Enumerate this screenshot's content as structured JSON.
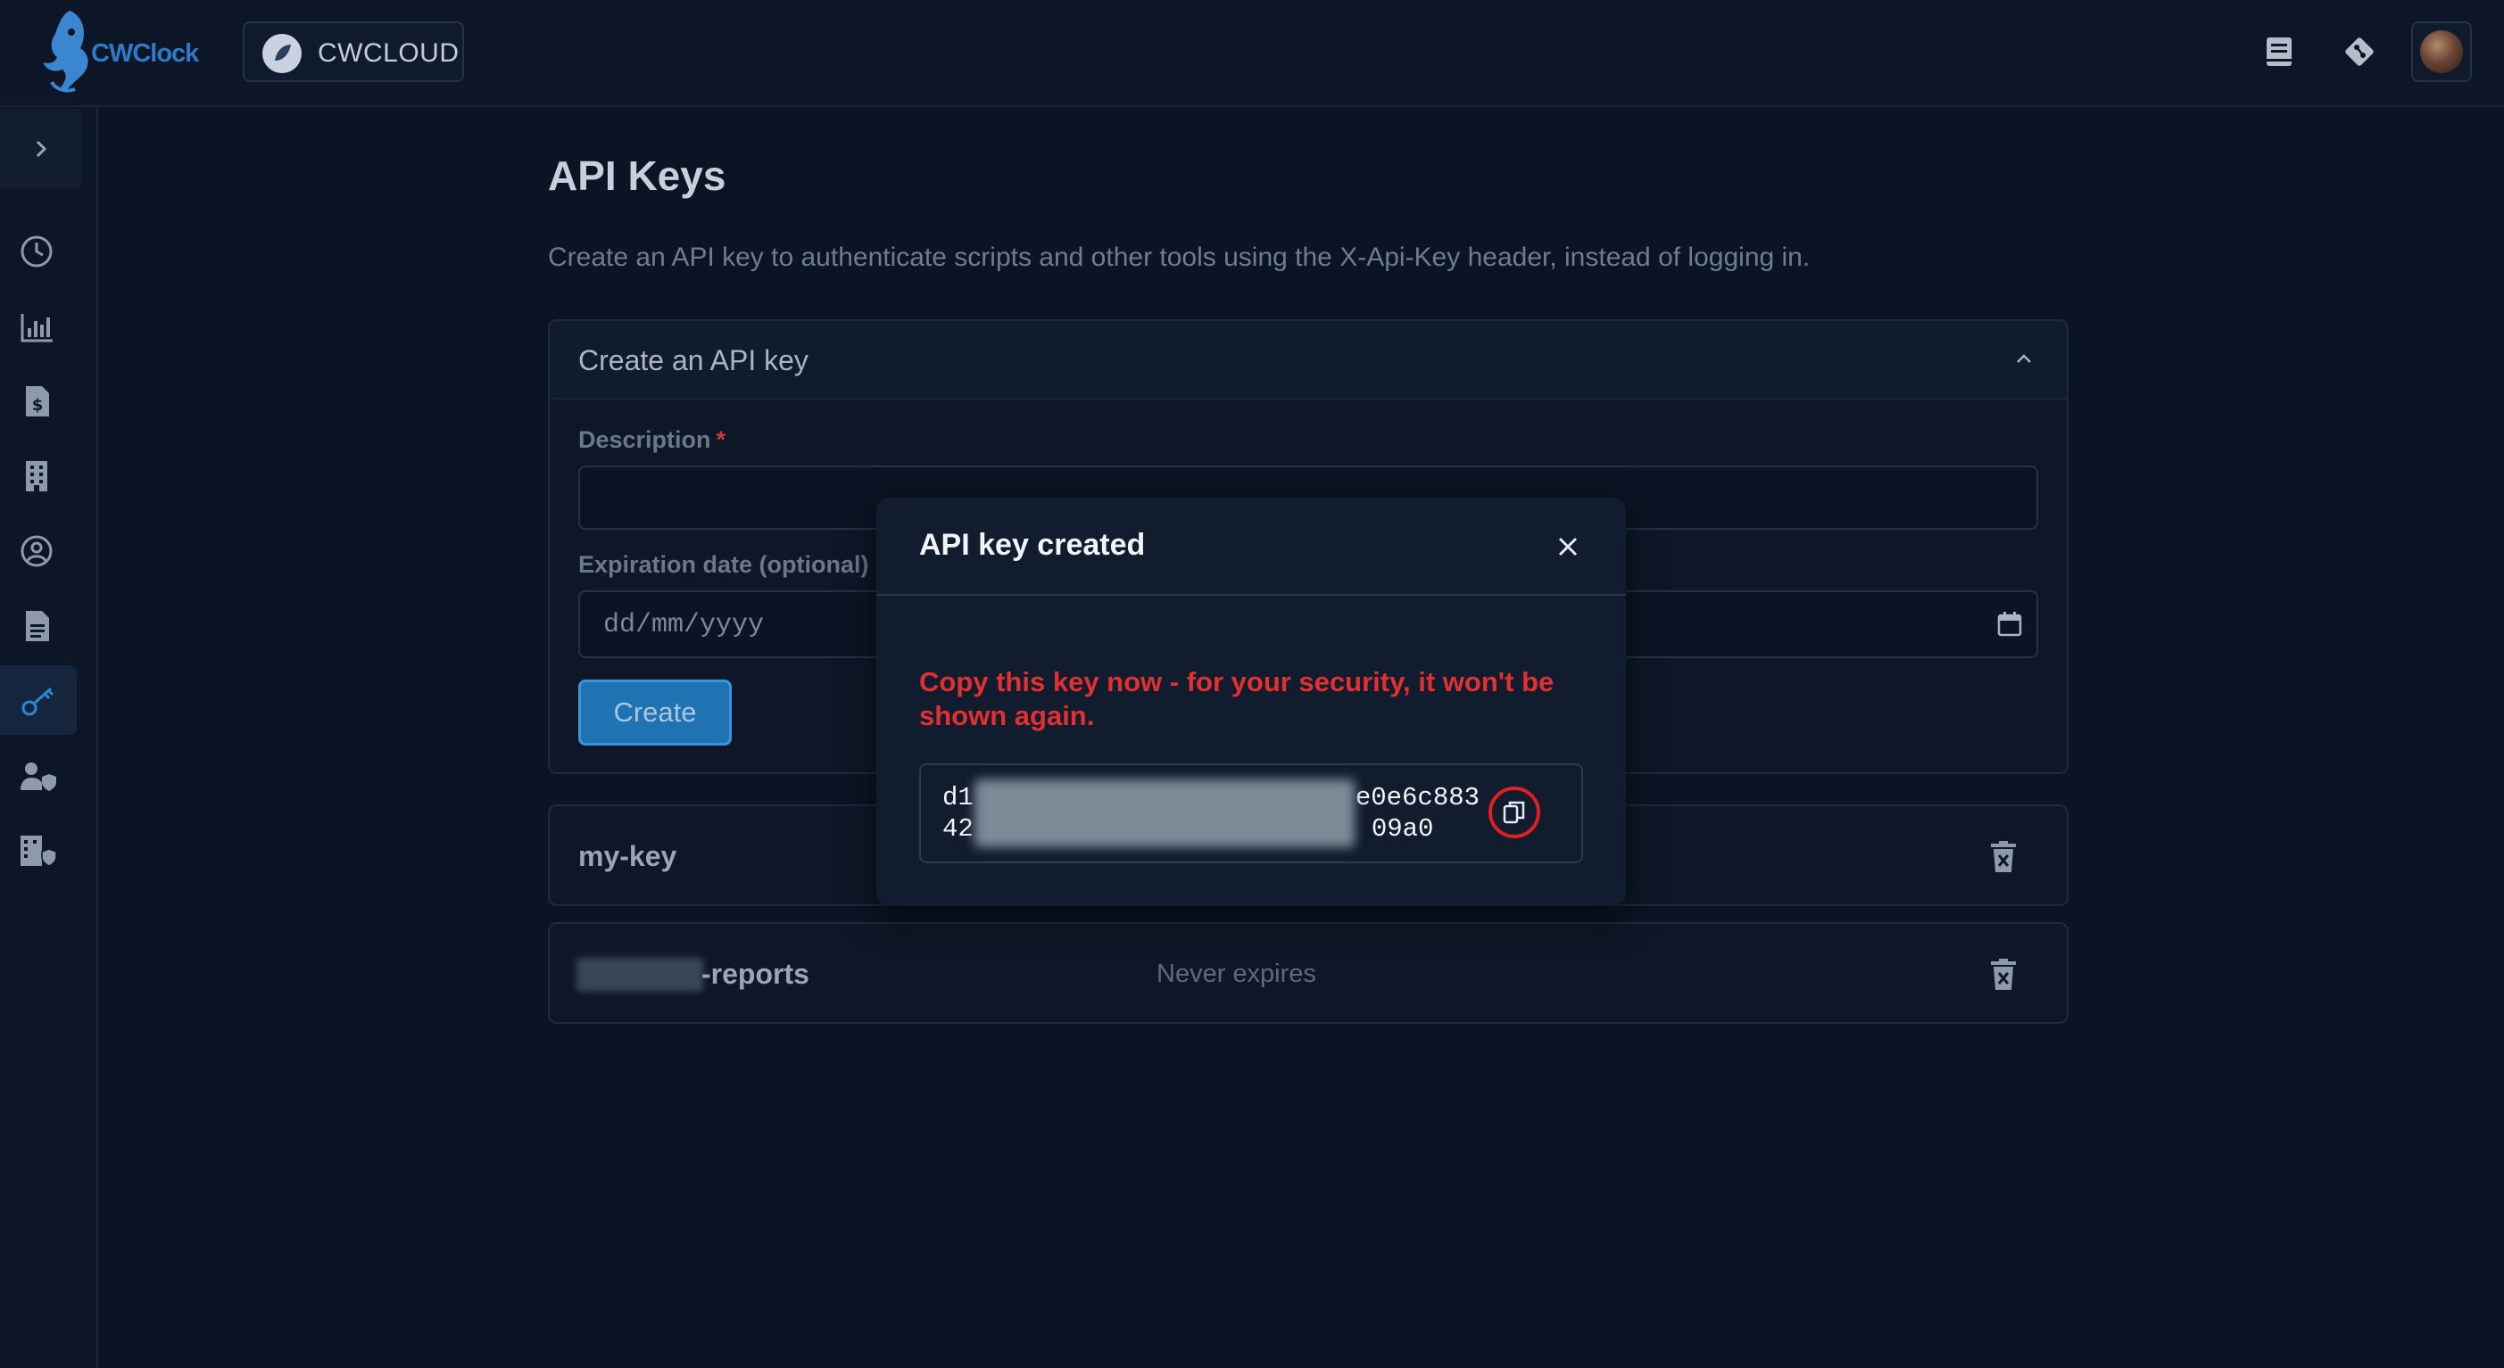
{
  "app": {
    "logo_text": "CWClock"
  },
  "header": {
    "org_name": "CWCLOUD"
  },
  "sidebar": {
    "items": [
      {
        "icon": "clock-icon",
        "active": false
      },
      {
        "icon": "bar-chart-icon",
        "active": false
      },
      {
        "icon": "invoice-icon",
        "active": false
      },
      {
        "icon": "building-icon",
        "active": false
      },
      {
        "icon": "user-circle-icon",
        "active": false
      },
      {
        "icon": "document-icon",
        "active": false
      },
      {
        "icon": "key-icon",
        "active": true
      },
      {
        "icon": "user-shield-icon",
        "active": false
      },
      {
        "icon": "building-shield-icon",
        "active": false
      }
    ]
  },
  "main": {
    "title": "API Keys",
    "description": "Create an API key to authenticate scripts and other tools using the X-Api-Key header, instead of logging in.",
    "create_panel": {
      "title": "Create an API key",
      "description_label": "Description",
      "required_mark": "*",
      "description_value": "",
      "expiration_label": "Expiration date (optional)",
      "date_placeholder": "dd/mm/yyyy",
      "create_button": "Create"
    },
    "keys": [
      {
        "name": "my-key",
        "expiry": ""
      },
      {
        "name": "-reports",
        "expiry": "Never expires"
      }
    ]
  },
  "modal": {
    "title": "API key created",
    "warning": "Copy this key now - for your security, it won't be shown again.",
    "key_line1_start": "d1",
    "key_line1_end": "e0e6c883",
    "key_line2_start": "42",
    "key_line2_end": "09a0"
  },
  "colors": {
    "background": "#0b1424",
    "accent": "#1f73b3",
    "warning": "#e0302f",
    "highlight_ring": "#e02020"
  }
}
